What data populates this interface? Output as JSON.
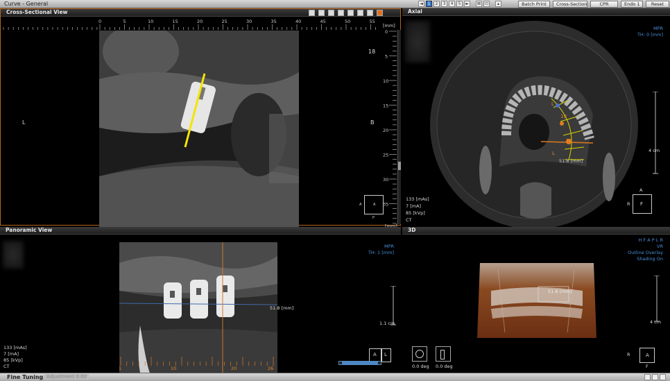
{
  "titlebar": {
    "title": "Curve - General",
    "nav_buttons": [
      "◄",
      "1",
      "2",
      "3",
      "4",
      "5",
      "►",
      "⊠",
      "⊡",
      "▴"
    ],
    "actions": [
      "Batch Print",
      "Cross-Section",
      "CPR",
      "Endo 1",
      "Reset"
    ]
  },
  "cross_section": {
    "title": "Cross-Sectional View",
    "top_ticks": [
      "0",
      "5",
      "10",
      "15",
      "20",
      "25",
      "30",
      "35",
      "40",
      "45",
      "50",
      "55"
    ],
    "top_unit": "[mm]",
    "right_ticks": [
      "0",
      "5",
      "10",
      "15",
      "20",
      "25",
      "30",
      "35"
    ],
    "right_unit": "[mm]",
    "slice_number": "18",
    "left_label": "L",
    "right_label": "B",
    "orient": {
      "left": "A",
      "center": "A",
      "bottom": "P"
    }
  },
  "axial": {
    "title": "Axial",
    "mode": "MPR",
    "thickness": "TH: 0 [mm]",
    "scale": "4 cm",
    "measurement": "51.8 [mm]",
    "marks": {
      "10": "10",
      "20": "20",
      "l_top": "L",
      "l_bottom": "L"
    },
    "scan": [
      "133 [mAs]",
      "7 [mA]",
      "85 [kVp]",
      "CT"
    ],
    "orient": {
      "top": "A",
      "left": "R",
      "center": "F"
    }
  },
  "panoramic": {
    "title": "Panoramic View",
    "mode": "MPR",
    "thickness": "TH: 1 [mm]",
    "measurement": "51.8 [mm]",
    "scale": "1.1 cm",
    "scan": [
      "133 [mAs]",
      "7 [mA]",
      "85 [kVp]",
      "CT"
    ],
    "ticks": [
      "1",
      "10",
      "20",
      "26"
    ],
    "orient": {
      "a": "A",
      "l": "L"
    }
  },
  "view3d": {
    "title": "3D",
    "directions": "H F A P L R",
    "mode": "VR",
    "overlay": "Outline Overlay",
    "shading": "Shading On",
    "measurement": "51.8 [mm]",
    "scale": "4 cm",
    "rot1": "0.0 deg",
    "rot2": "0.0 deg",
    "orient": {
      "left": "R",
      "center": "A",
      "bottom": "F"
    }
  },
  "bottombar": {
    "label": "Fine Tuning",
    "dim": "Adjustment 0.00"
  }
}
